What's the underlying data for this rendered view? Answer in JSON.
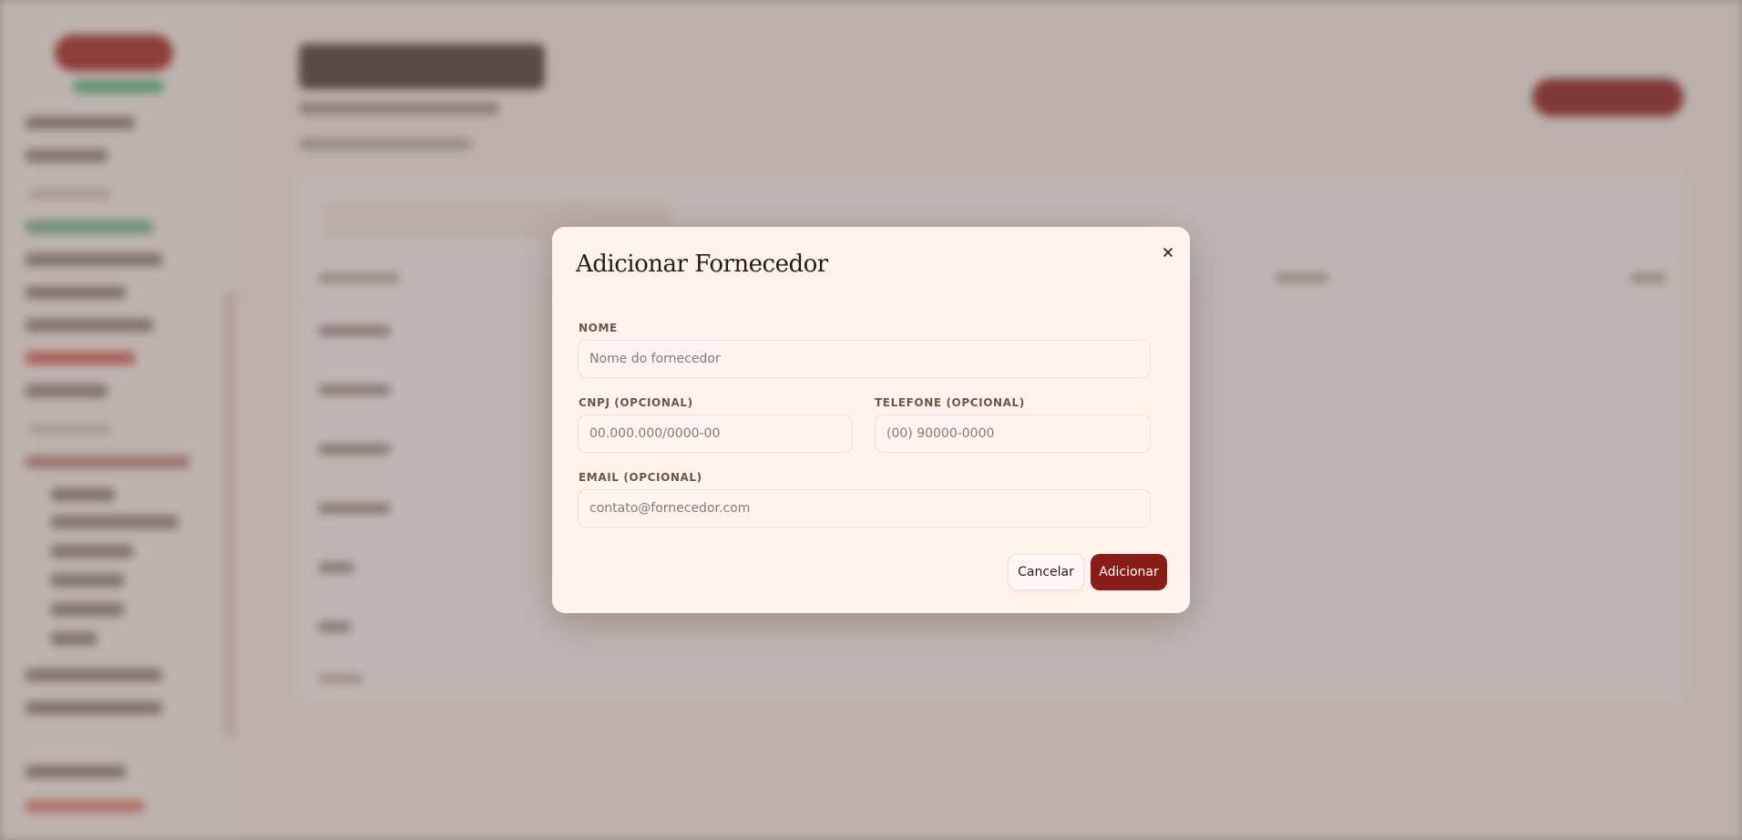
{
  "modal": {
    "title": "Adicionar Fornecedor",
    "close_icon": "close-icon",
    "fields": {
      "nome": {
        "label": "NOME",
        "placeholder": "Nome do fornecedor",
        "value": ""
      },
      "cnpj": {
        "label": "CNPJ (OPCIONAL)",
        "placeholder": "00.000.000/0000-00",
        "value": ""
      },
      "telefone": {
        "label": "TELEFONE (OPCIONAL)",
        "placeholder": "(00) 90000-0000",
        "value": ""
      },
      "email": {
        "label": "EMAIL (OPCIONAL)",
        "placeholder": "contato@fornecedor.com",
        "value": ""
      }
    },
    "buttons": {
      "cancel": "Cancelar",
      "add": "Adicionar"
    }
  },
  "colors": {
    "accent": "#8a1c18",
    "modal_bg": "#fff3ec",
    "backdrop": "#b7aba7"
  }
}
